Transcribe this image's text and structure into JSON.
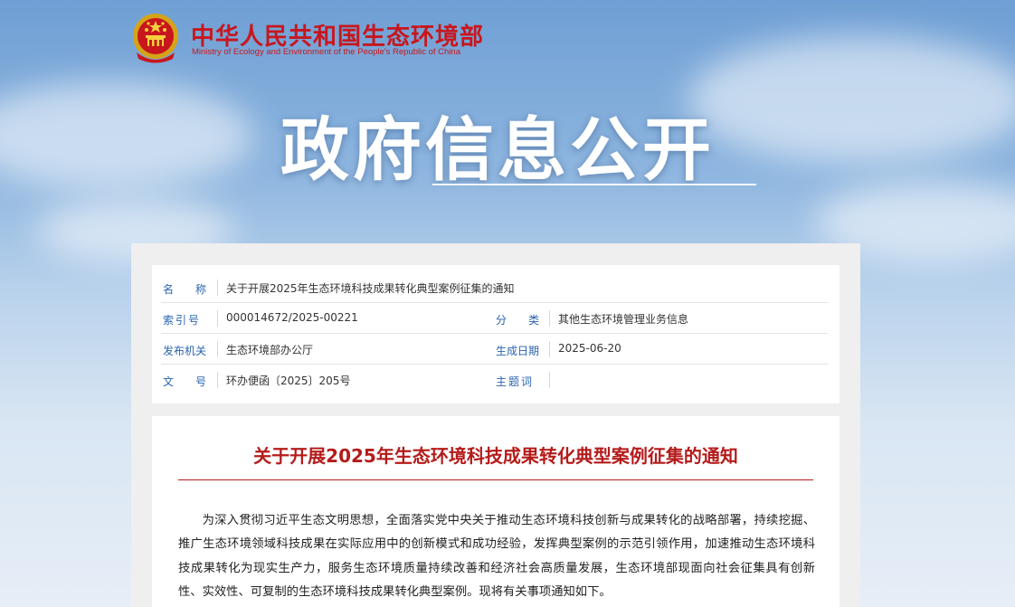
{
  "site": {
    "name_cn": "中华人民共和国生态环境部",
    "name_en": "Ministry of Ecology and Environment of the People's Republic of China"
  },
  "hero": {
    "title": "政府信息公开"
  },
  "meta": {
    "name": {
      "label": "名　　称",
      "value": "关于开展2025年生态环境科技成果转化典型案例征集的通知"
    },
    "index": {
      "label": "索引号",
      "value": "000014672/2025-00221"
    },
    "category": {
      "label": "分　　类",
      "value": "其他生态环境管理业务信息"
    },
    "publisher": {
      "label": "发布机关",
      "value": "生态环境部办公厅"
    },
    "date": {
      "label": "生成日期",
      "value": "2025-06-20"
    },
    "doc_no": {
      "label": "文　　号",
      "value": "环办便函〔2025〕205号"
    },
    "subject": {
      "label": "主题词",
      "value": ""
    }
  },
  "article": {
    "title": "关于开展2025年生态环境科技成果转化典型案例征集的通知",
    "paragraph1": "为深入贯彻习近平生态文明思想，全面落实党中央关于推动生态环境科技创新与成果转化的战略部署，持续挖掘、推广生态环境领域科技成果在实际应用中的创新模式和成功经验，发挥典型案例的示范引领作用，加速推动生态环境科技成果转化为现实生产力，服务生态环境质量持续改善和经济社会高质量发展，生态环境部现面向社会征集具有创新性、实效性、可复制的生态环境科技成果转化典型案例。现将有关事项通知如下。"
  },
  "colors": {
    "brand_red": "#c8161d",
    "label_blue": "#2a64b0",
    "title_red": "#b51b1b"
  }
}
